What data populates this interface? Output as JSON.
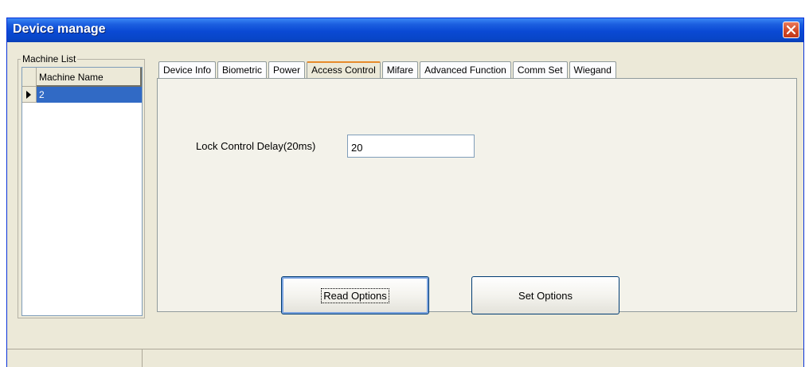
{
  "window": {
    "title": "Device manage"
  },
  "machine_list": {
    "group_label": "Machine List",
    "column_header": "Machine Name",
    "rows": [
      "2"
    ]
  },
  "tabs": [
    {
      "label": "Device Info",
      "active": false
    },
    {
      "label": "Biometric",
      "active": false
    },
    {
      "label": "Power",
      "active": false
    },
    {
      "label": "Access Control",
      "active": true
    },
    {
      "label": "Mifare",
      "active": false
    },
    {
      "label": "Advanced Function",
      "active": false
    },
    {
      "label": "Comm Set",
      "active": false
    },
    {
      "label": "Wiegand",
      "active": false
    }
  ],
  "access_control": {
    "lock_delay_label": "Lock Control Delay(20ms)",
    "lock_delay_value": "20",
    "read_button": "Read Options",
    "set_button": "Set Options"
  },
  "colors": {
    "title_bar": "#0a49d4",
    "selection": "#316ac5",
    "window_bg": "#ece9d8",
    "active_tab_accent": "#e68b2c"
  },
  "icons": {
    "close": "close-icon",
    "row_pointer": "row-pointer-icon"
  }
}
